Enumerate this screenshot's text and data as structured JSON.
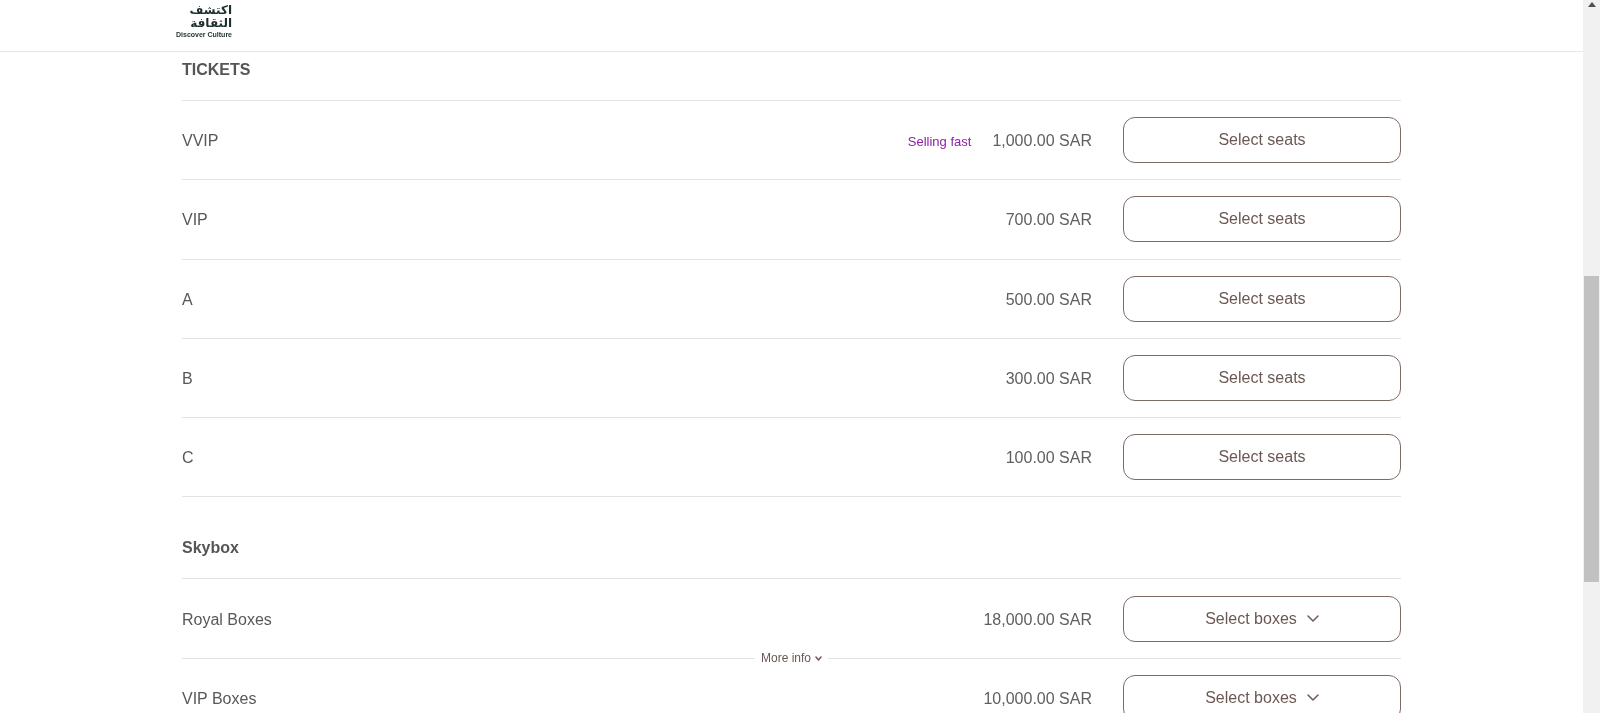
{
  "header": {
    "logo": {
      "arabic_lines": [
        "اكتشف",
        "الثقافة"
      ],
      "english": "Discover Culture"
    }
  },
  "sections": [
    {
      "title": "TICKETS",
      "rows": [
        {
          "name": "VVIP",
          "badge": "Selling fast",
          "price": "1,000.00 SAR",
          "button": "Select seats",
          "dropdown": false
        },
        {
          "name": "VIP",
          "price": "700.00 SAR",
          "button": "Select seats",
          "dropdown": false
        },
        {
          "name": "A",
          "price": "500.00 SAR",
          "button": "Select seats",
          "dropdown": false
        },
        {
          "name": "B",
          "price": "300.00 SAR",
          "button": "Select seats",
          "dropdown": false
        },
        {
          "name": "C",
          "price": "100.00 SAR",
          "button": "Select seats",
          "dropdown": false
        }
      ]
    },
    {
      "title": "Skybox",
      "rows": [
        {
          "name": "Royal Boxes",
          "price": "18,000.00 SAR",
          "button": "Select boxes",
          "dropdown": true,
          "more_info": "More info"
        },
        {
          "name": "VIP Boxes",
          "price": "10,000.00 SAR",
          "button": "Select boxes",
          "dropdown": true
        }
      ]
    }
  ]
}
